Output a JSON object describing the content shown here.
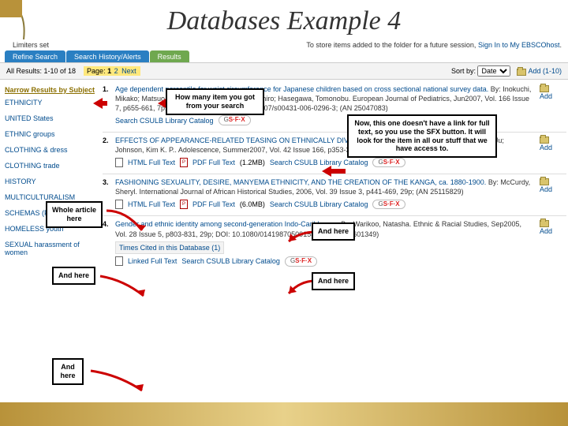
{
  "presentation_title": "Databases Example 4",
  "limiters_label": "Limiters set",
  "folder_note_prefix": "To store items added to the folder for a future session, ",
  "signin_link": "Sign In to My EBSCOhost",
  "tabs": {
    "refine": "Refine Search",
    "history": "Search History/Alerts",
    "results": "Results"
  },
  "results_summary": "All Results: 1-10 of 18",
  "page_label": "Page: ",
  "page_current": "1",
  "page_2": "2",
  "page_next": "Next",
  "sort_label": "Sort by:",
  "sort_value": "Date",
  "add_range": "Add (1-10)",
  "sidebar": {
    "title": "Narrow Results by Subject",
    "items": [
      "ETHNICITY",
      "UNITED States",
      "ETHNIC groups",
      "CLOTHING & dress",
      "CLOTHING trade",
      "HISTORY",
      "MULTICULTURALISM",
      "SCHEMAS (Psychology)",
      "HOMELESS youth",
      "SEXUAL harassment of women"
    ]
  },
  "results": [
    {
      "title": "Age dependent percentile for waist circumference for Japanese children based on cross sectional national survey data.",
      "by": "By: Inokuchi, Mikako; Matsuo, Nobutake; Takayama, John Ichiro; Hasegawa, Tomonobu. European Journal of Pediatrics, Jun2007, Vol. 166 Issue 7, p655-661, 7p, 5 charts, 4 graphs; DOI: 10.1007/s00431-006-0296-3; (AN 25047083)",
      "links": {
        "catalog": "Search CSULB Library Catalog"
      }
    },
    {
      "title": "EFFECTS OF APPEARANCE-RELATED TEASING ON ETHNICALLY DIVERSE ADOLESCENT GIRLS.",
      "by": "By: Yoo, Jeong-Ju; Johnson, Kim K. P.. Adolescence, Summer2007, Vol. 42 Issue 166, p353-380, 28p, 6 charts; (AN 25160916)",
      "links": {
        "html": "HTML Full Text",
        "pdf": "PDF Full Text",
        "pdf_size": "(1.2MB)",
        "catalog": "Search CSULB Library Catalog"
      }
    },
    {
      "title": "FASHIONING SEXUALITY, DESIRE, MANYEMA ETHNICITY, AND THE CREATION OF THE KANGA, ca. 1880-1900.",
      "by": "By: McCurdy, Sheryl. International Journal of African Historical Studies, 2006, Vol. 39 Issue 3, p441-469, 29p; (AN 25115829)",
      "links": {
        "html": "HTML Full Text",
        "pdf": "PDF Full Text",
        "pdf_size": "(6.0MB)",
        "catalog": "Search CSULB Library Catalog"
      }
    },
    {
      "title": "Gender and ethnic identity among second-generation Indo-Caribbeans.",
      "by": "By: Warikoo, Natasha. Ethnic & Racial Studies, Sep2005, Vol. 28 Issue 5, p803-831, 29p; DOI: 10.1080/01419870500158752; (AN 17601349)",
      "links": {
        "times_cited": "Times Cited in this Database (1)",
        "linked": "Linked Full Text",
        "catalog": "Search CSULB Library Catalog"
      }
    }
  ],
  "add_label": "Add",
  "callouts": {
    "c1": "How many item you got from your search",
    "c2": "Now, this one doesn't have a link for full text, so you use the SFX button. It will look for the item in all our stuff that we have access to.",
    "c3": "Whole article here",
    "c4": "And here",
    "c5": "And here",
    "c6": "And here"
  }
}
